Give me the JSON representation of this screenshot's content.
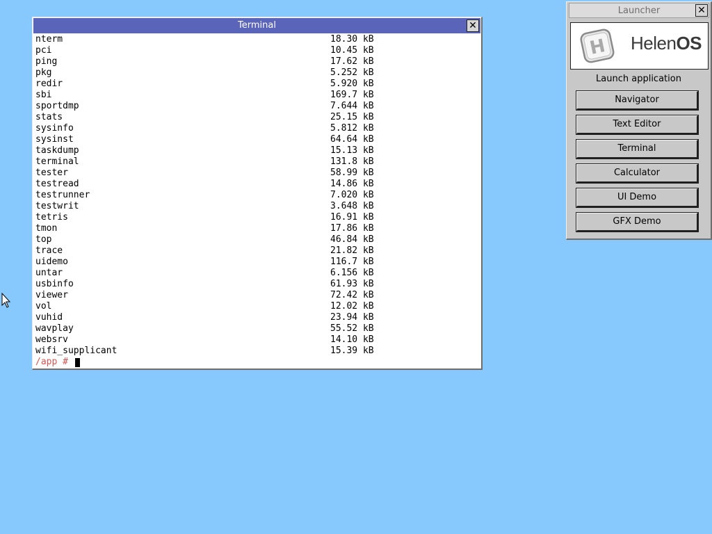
{
  "terminal": {
    "title": "Terminal",
    "close_glyph": "✕",
    "listing": [
      {
        "name": "nterm",
        "size": "18.30 kB"
      },
      {
        "name": "pci",
        "size": "10.45 kB"
      },
      {
        "name": "ping",
        "size": "17.62 kB"
      },
      {
        "name": "pkg",
        "size": "5.252 kB"
      },
      {
        "name": "redir",
        "size": "5.920 kB"
      },
      {
        "name": "sbi",
        "size": "169.7 kB"
      },
      {
        "name": "sportdmp",
        "size": "7.644 kB"
      },
      {
        "name": "stats",
        "size": "25.15 kB"
      },
      {
        "name": "sysinfo",
        "size": "5.812 kB"
      },
      {
        "name": "sysinst",
        "size": "64.64 kB"
      },
      {
        "name": "taskdump",
        "size": "15.13 kB"
      },
      {
        "name": "terminal",
        "size": "131.8 kB"
      },
      {
        "name": "tester",
        "size": "58.99 kB"
      },
      {
        "name": "testread",
        "size": "14.86 kB"
      },
      {
        "name": "testrunner",
        "size": "7.020 kB"
      },
      {
        "name": "testwrit",
        "size": "3.648 kB"
      },
      {
        "name": "tetris",
        "size": "16.91 kB"
      },
      {
        "name": "tmon",
        "size": "17.86 kB"
      },
      {
        "name": "top",
        "size": "46.84 kB"
      },
      {
        "name": "trace",
        "size": "21.82 kB"
      },
      {
        "name": "uidemo",
        "size": "116.7 kB"
      },
      {
        "name": "untar",
        "size": "6.156 kB"
      },
      {
        "name": "usbinfo",
        "size": "61.93 kB"
      },
      {
        "name": "viewer",
        "size": "72.42 kB"
      },
      {
        "name": "vol",
        "size": "12.02 kB"
      },
      {
        "name": "vuhid",
        "size": "23.94 kB"
      },
      {
        "name": "wavplay",
        "size": "55.52 kB"
      },
      {
        "name": "websrv",
        "size": "14.10 kB"
      },
      {
        "name": "wifi_supplicant",
        "size": "15.39 kB"
      }
    ],
    "prompt": "/app # ",
    "prompt_color": "#d95454"
  },
  "launcher": {
    "title": "Launcher",
    "close_glyph": "✕",
    "logo_letter": "H",
    "brand_light": "Helen",
    "brand_bold": "OS",
    "heading": "Launch application",
    "buttons": [
      "Navigator",
      "Text Editor",
      "Terminal",
      "Calculator",
      "UI Demo",
      "GFX Demo"
    ]
  },
  "colors": {
    "desktop": "#87c9fd",
    "active_titlebar": "#5a64b8",
    "inactive_titlebar": "#dcdcdc",
    "window_face": "#c8c8c8"
  },
  "icons": {
    "pointer": "arrow-cursor-icon",
    "logo": "helenos-h-icon"
  }
}
